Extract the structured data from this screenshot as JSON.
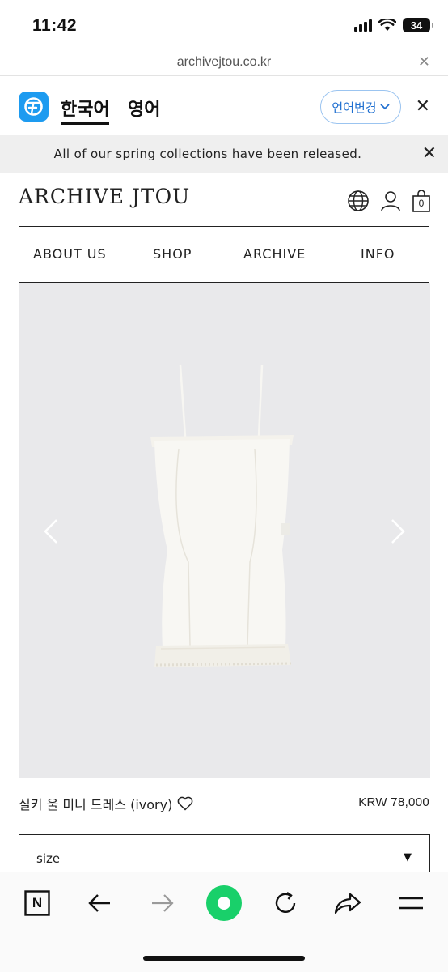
{
  "status_bar": {
    "time": "11:42",
    "battery": "34",
    "icons": [
      "signal-icon",
      "wifi-icon",
      "battery-icon"
    ]
  },
  "browser": {
    "url": "archivejtou.co.kr",
    "close_icon": "close-icon"
  },
  "translate_bar": {
    "app_icon": "papago-icon",
    "source_lang": "한국어",
    "target_lang": "영어",
    "change_button": "언어변경",
    "accent_color": "#1f6fd0"
  },
  "announcement": {
    "text": "All of our spring collections have been released."
  },
  "site": {
    "logo": "ARCHIVE JTOU",
    "header_icons": [
      "globe-icon",
      "user-icon",
      "cart-icon"
    ],
    "cart_count": "0",
    "nav": [
      "ABOUT US",
      "SHOP",
      "ARCHIVE",
      "INFO"
    ]
  },
  "product": {
    "name": "실키 울 미니 드레스 (ivory)",
    "price": "KRW 78,000",
    "image_alt": "ivory mini slip dress",
    "size_label": "size",
    "size_caret": "▼"
  },
  "toolbar": {
    "buttons": [
      "naver-icon",
      "back-icon",
      "forward-icon",
      "green-dot-icon",
      "reload-icon",
      "share-icon",
      "menu-icon"
    ],
    "naver_letter": "N",
    "accent_color": "#19d06a"
  }
}
